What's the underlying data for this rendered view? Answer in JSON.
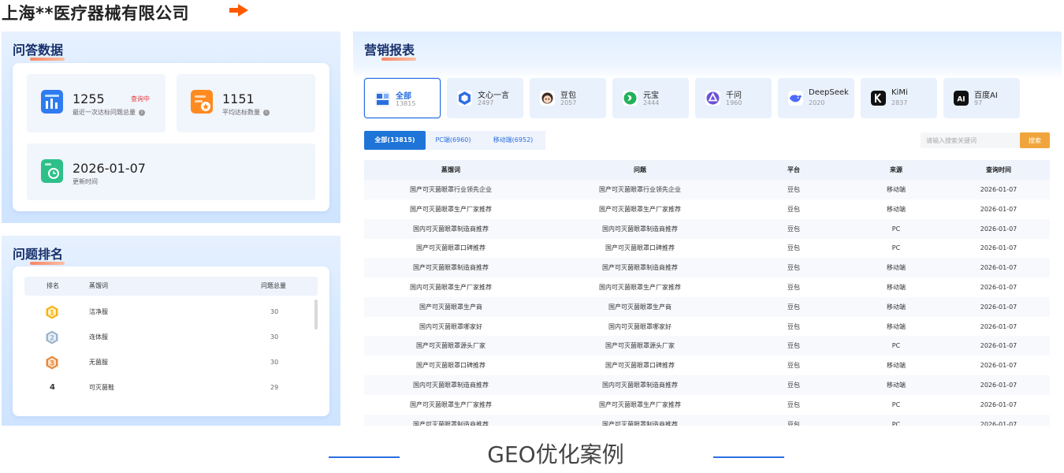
{
  "company": {
    "title": "上海**医疗器械有限公司",
    "arrow_color": "#ff5a00"
  },
  "qa_panel": {
    "title": "问答数据",
    "stats": [
      {
        "value": "1255",
        "label": "最近一次达标问题总量",
        "badge": "查询中",
        "icon": "chart-icon",
        "icon_color": "#2f7cf0"
      },
      {
        "value": "1151",
        "label": "平均达标数量",
        "icon": "star-doc-icon",
        "icon_color": "#ff8a1f"
      },
      {
        "value": "2026-01-07",
        "label": "更新时间",
        "icon": "refresh-icon",
        "icon_color": "#2ec08a"
      }
    ]
  },
  "rank_panel": {
    "title": "问题排名",
    "headers": [
      "排名",
      "蒸馏词",
      "问题总量"
    ],
    "rows": [
      {
        "rank": "1",
        "keyword": "洁净服",
        "total": "30",
        "medal": "gold"
      },
      {
        "rank": "2",
        "keyword": "连体服",
        "total": "30",
        "medal": "silver"
      },
      {
        "rank": "3",
        "keyword": "无菌服",
        "total": "30",
        "medal": "bronze"
      },
      {
        "rank": "4",
        "keyword": "可灭菌鞋",
        "total": "29",
        "medal": ""
      }
    ]
  },
  "report_panel": {
    "title": "营销报表",
    "platforms": [
      {
        "name": "全部",
        "count": "13815",
        "icon": "grid-icon",
        "active": true
      },
      {
        "name": "文心一言",
        "count": "2497",
        "icon": "wenxin-icon"
      },
      {
        "name": "豆包",
        "count": "2057",
        "icon": "doubao-icon"
      },
      {
        "name": "元宝",
        "count": "2444",
        "icon": "yuanbao-icon"
      },
      {
        "name": "千问",
        "count": "1960",
        "icon": "qianwen-icon"
      },
      {
        "name": "DeepSeek",
        "count": "2020",
        "icon": "deepseek-icon"
      },
      {
        "name": "KiMi",
        "count": "2837",
        "icon": "kimi-icon"
      },
      {
        "name": "百度AI",
        "count": "97",
        "icon": "baidu-ai-icon"
      }
    ],
    "tabs": [
      "全部(13815)",
      "PC端(6960)",
      "移动端(6952)"
    ],
    "search": {
      "placeholder": "请输入搜索关键词",
      "button": "搜索"
    },
    "table": {
      "headers": [
        "蒸馏词",
        "问题",
        "平台",
        "来源",
        "查询时间"
      ],
      "rows": [
        [
          "国产可灭菌眼罩行业领先企业",
          "国产可灭菌眼罩行业领先企业",
          "豆包",
          "移动端",
          "2026-01-07"
        ],
        [
          "国产可灭菌眼罩生产厂家推荐",
          "国产可灭菌眼罩生产厂家推荐",
          "豆包",
          "移动端",
          "2026-01-07"
        ],
        [
          "国内可灭菌眼罩制造商推荐",
          "国内可灭菌眼罩制造商推荐",
          "豆包",
          "PC",
          "2026-01-07"
        ],
        [
          "国产可灭菌眼罩口碑推荐",
          "国产可灭菌眼罩口碑推荐",
          "豆包",
          "PC",
          "2026-01-07"
        ],
        [
          "国产可灭菌眼罩制造商推荐",
          "国产可灭菌眼罩制造商推荐",
          "豆包",
          "移动端",
          "2026-01-07"
        ],
        [
          "国内可灭菌眼罩生产厂家推荐",
          "国内可灭菌眼罩生产厂家推荐",
          "豆包",
          "移动端",
          "2026-01-07"
        ],
        [
          "国产可灭菌眼罩生产商",
          "国产可灭菌眼罩生产商",
          "豆包",
          "移动端",
          "2026-01-07"
        ],
        [
          "国内可灭菌眼罩哪家好",
          "国内可灭菌眼罩哪家好",
          "豆包",
          "移动端",
          "2026-01-07"
        ],
        [
          "国产可灭菌眼罩源头厂家",
          "国产可灭菌眼罩源头厂家",
          "豆包",
          "PC",
          "2026-01-07"
        ],
        [
          "国产可灭菌眼罩口碑推荐",
          "国产可灭菌眼罩口碑推荐",
          "豆包",
          "移动端",
          "2026-01-07"
        ],
        [
          "国内可灭菌眼罩制造商推荐",
          "国内可灭菌眼罩制造商推荐",
          "豆包",
          "移动端",
          "2026-01-07"
        ],
        [
          "国产可灭菌眼罩生产厂家推荐",
          "国产可灭菌眼罩生产厂家推荐",
          "豆包",
          "PC",
          "2026-01-07"
        ],
        [
          "国产可灭菌眼罩制造商推荐",
          "国产可灭菌眼罩制造商推荐",
          "豆包",
          "PC",
          "2026-01-07"
        ]
      ]
    }
  },
  "footer": {
    "title": "GEO优化案例"
  }
}
